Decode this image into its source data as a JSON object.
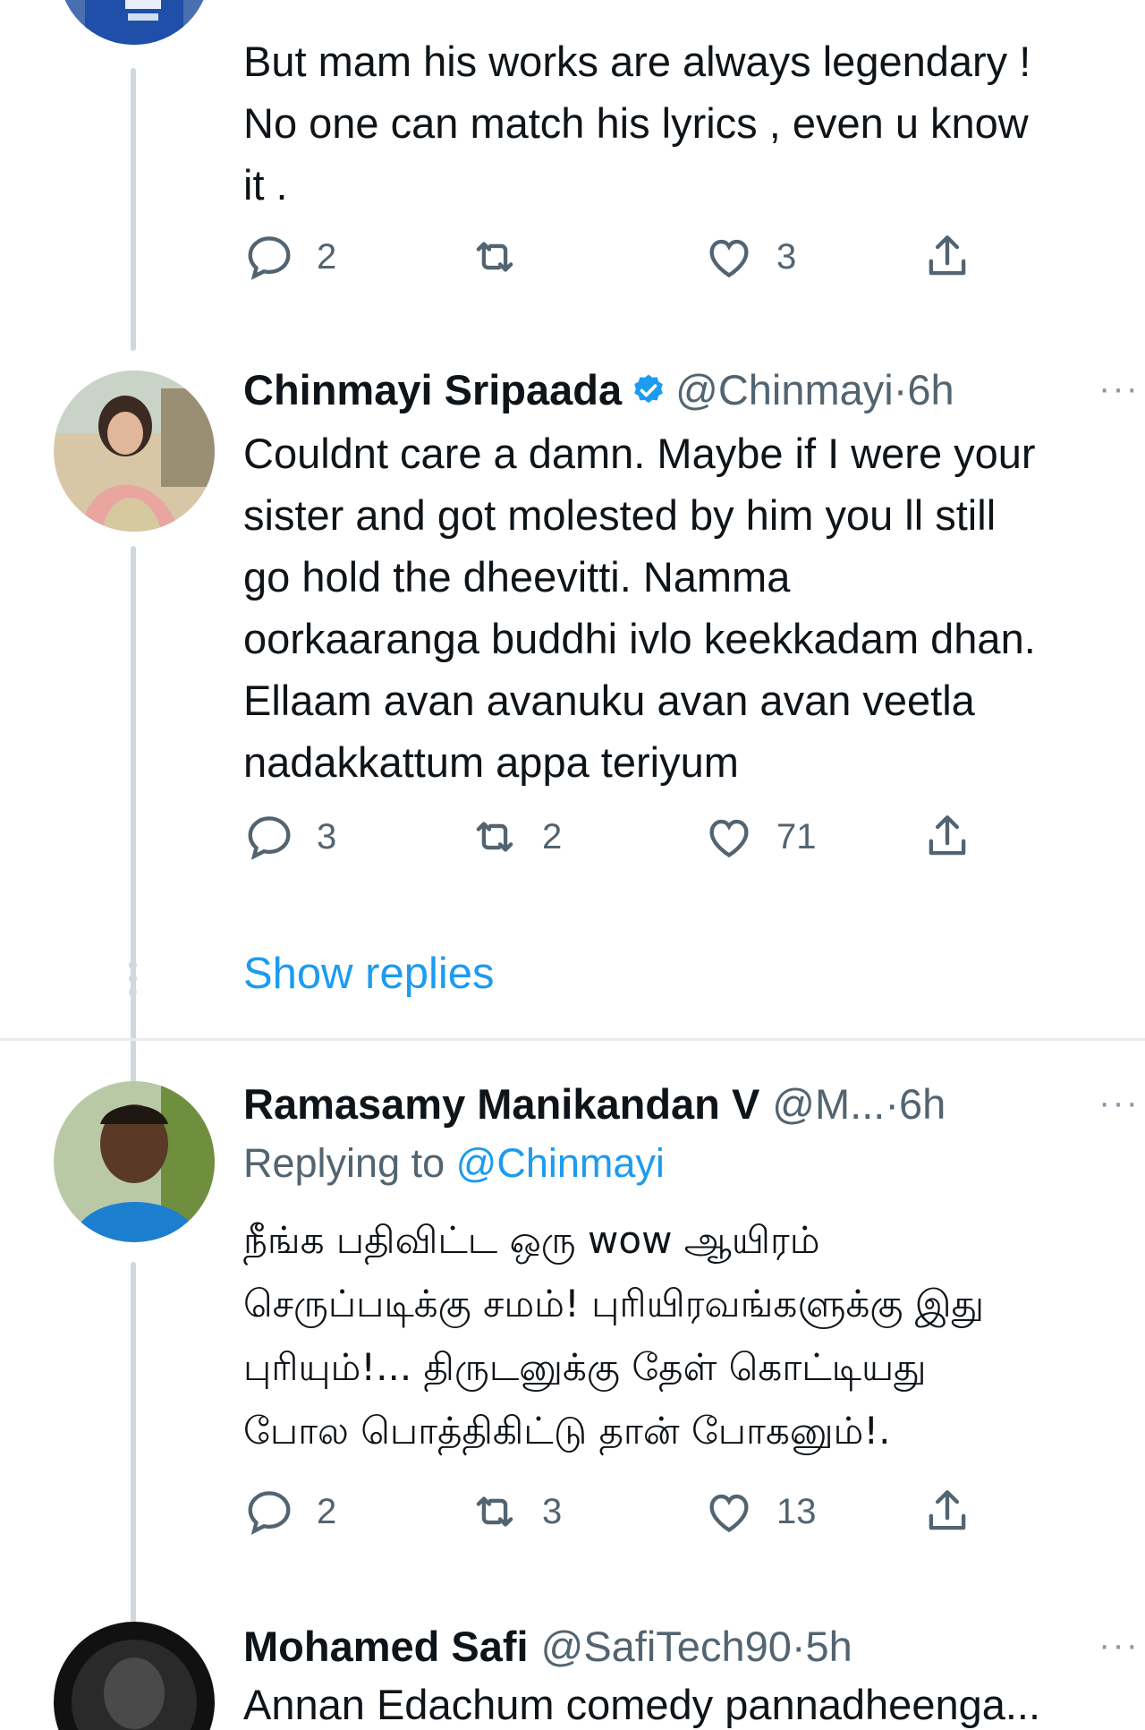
{
  "tweets": [
    {
      "body": "But mam his works are always legendary !\nNo one can match his lyrics , even u know\nit .",
      "actions": {
        "reply": "2",
        "retweet": "",
        "like": "3"
      }
    },
    {
      "name": "Chinmayi Sripaada",
      "handle": "@Chinmayi",
      "dot": "·",
      "time": "6h",
      "verified": true,
      "body": "Couldnt care a damn. Maybe if I were your\nsister and got molested by him you ll still\ngo hold the dheevitti. Namma\noorkaaranga buddhi ivlo keekkadam dhan.\nEllaam avan avanuku avan avan veetla\nnadakkattum appa teriyum",
      "actions": {
        "reply": "3",
        "retweet": "2",
        "like": "71"
      }
    },
    {
      "name": "Ramasamy Manikandan V",
      "handle": "@M...",
      "dot": "·",
      "time": "6h",
      "replying_prefix": "Replying to ",
      "replying_to": "@Chinmayi",
      "body": "நீங்க பதிவிட்ட ஒரு wow ஆயிரம்\nசெருப்படிக்கு சமம்! புரியிரவங்களுக்கு இது\nபுரியும்!... திருடனுக்கு தேள் கொட்டியது\nபோல பொத்திகிட்டு தான் போகனும்!.",
      "actions": {
        "reply": "2",
        "retweet": "3",
        "like": "13"
      }
    },
    {
      "name": "Mohamed Safi",
      "handle": "@SafiTech90",
      "dot": "·",
      "time": "5h",
      "body": "Annan Edachum comedy pannadheenga..."
    }
  ],
  "show_replies": "Show replies",
  "more_glyph": "···",
  "icons": [
    "reply-icon",
    "retweet-icon",
    "like-icon",
    "share-icon",
    "verified-badge-icon",
    "more-options-icon"
  ],
  "colors": {
    "link": "#1d9bf0",
    "muted": "#536471",
    "thread_line": "#cfd9de",
    "text": "#0f1419"
  }
}
